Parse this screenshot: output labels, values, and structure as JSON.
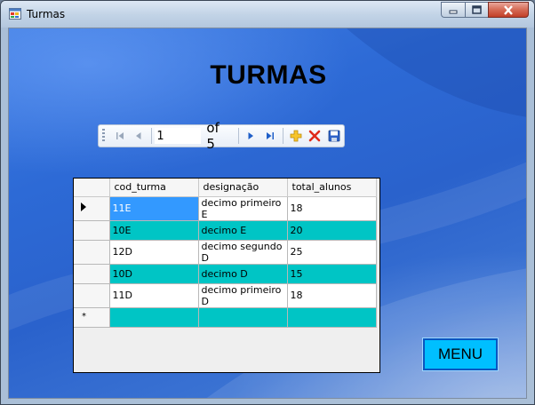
{
  "window": {
    "title": "Turmas"
  },
  "page": {
    "heading": "TURMAS"
  },
  "navigator": {
    "position": "1",
    "count_label": "of 5"
  },
  "grid": {
    "columns": [
      "cod_turma",
      "designação",
      "total_alunos"
    ],
    "rows": [
      {
        "cod_turma": "11E",
        "designacao": "decimo primeiro E",
        "total_alunos": "18",
        "color": "white"
      },
      {
        "cod_turma": "10E",
        "designacao": "decimo E",
        "total_alunos": "20",
        "color": "teal"
      },
      {
        "cod_turma": "12D",
        "designacao": "decimo segundo D",
        "total_alunos": "25",
        "color": "white"
      },
      {
        "cod_turma": "10D",
        "designacao": "decimo D",
        "total_alunos": "15",
        "color": "teal"
      },
      {
        "cod_turma": "11D",
        "designacao": "decimo primeiro D",
        "total_alunos": "18",
        "color": "white"
      }
    ],
    "new_row_marker": "*"
  },
  "buttons": {
    "menu_label": "MENU"
  },
  "colors": {
    "teal_row": "#00c5c5",
    "selected_cell": "#3399ff",
    "menu_button": "#00bfff",
    "desktop_blue": "#2d6ad6"
  },
  "icons": {
    "app": "window-app-icon",
    "move_first": "move-first-icon",
    "move_previous": "move-previous-icon",
    "move_next": "move-next-icon",
    "move_last": "move-last-icon",
    "add_new": "add-new-icon",
    "delete": "delete-icon",
    "save": "save-icon"
  }
}
